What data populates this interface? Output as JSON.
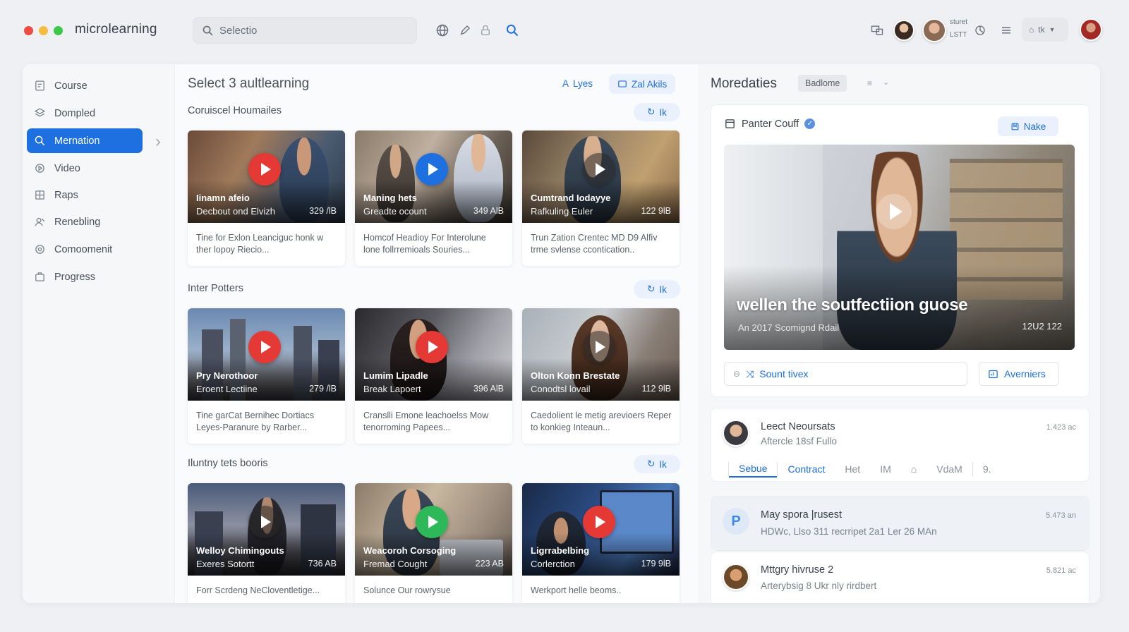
{
  "app": {
    "title": "microlearning",
    "window_dots": [
      "#ee4c43",
      "#f4bd3d",
      "#3ec84a"
    ],
    "accent": "#1e6fe0"
  },
  "topbar": {
    "search_placeholder": "Selectio",
    "icons": [
      "globe-icon",
      "pen-icon",
      "lock-icon",
      "search-icon"
    ],
    "user_name": "sturet",
    "user_meta": "LSTT",
    "language": "tk"
  },
  "sidebar": {
    "items": [
      {
        "label": "Course",
        "icon": "course-icon",
        "active": false
      },
      {
        "label": "Dompled",
        "icon": "stack-icon",
        "active": false
      },
      {
        "label": "Mernation",
        "icon": "search-icon",
        "active": true
      },
      {
        "label": "Video",
        "icon": "video-icon",
        "active": false
      },
      {
        "label": "Raps",
        "icon": "grid-icon",
        "active": false
      },
      {
        "label": "Renebling",
        "icon": "user-icon",
        "active": false
      },
      {
        "label": "Comoomenit",
        "icon": "circle-icon",
        "active": false
      },
      {
        "label": "Progress",
        "icon": "briefcase-icon",
        "active": false
      }
    ]
  },
  "main": {
    "title": "Select 3 aultlearning",
    "actions": {
      "lyes": "Lyes",
      "zal_akils": "Zal Akils"
    },
    "sections": [
      {
        "title": "Coruiscel Houmailes",
        "chip": "Ik",
        "cards": [
          {
            "title": "Iinamn afeio",
            "subtitle": "Decbout ond Elvizh",
            "duration": "329 /lB",
            "description": "Tine for Exlon Leanciguc honk w ther lopoy Riecio...",
            "play_color": "#e53935"
          },
          {
            "title": "Maning hets",
            "subtitle": "Greadte ocount",
            "duration": "349 AlB",
            "description": "Homcof Headioy For Interolune lone follrremioals Souries...",
            "play_color": "#1e6fe0"
          },
          {
            "title": "Cumtrand Iodayye",
            "subtitle": "Rafkuling Euler",
            "duration": "122 9lB",
            "description": "Trun Zation Crentec MD D9 Alfiv trme svlense ccontication..",
            "play_color": "dark"
          }
        ]
      },
      {
        "title": "Inter Potters",
        "chip": "Ik",
        "cards": [
          {
            "title": "Pry Nerothoor",
            "subtitle": "Eroent Lectiine",
            "duration": "279 /lB",
            "description": "Tine garCat Bernihec Dortiacs Leyes-Paranure by Rarber...",
            "play_color": "#e53935"
          },
          {
            "title": "Lumim Lipadle",
            "subtitle": "Break Lapoert",
            "duration": "396 AlB",
            "description": "Cranslli Emone leachoelss Mow tenorroming Papees...",
            "play_color": "#e53935"
          },
          {
            "title": "Olton Konn Brestate",
            "subtitle": "Conodtsl lovail",
            "duration": "112 9lB",
            "description": "Caedolient le metig arevioers Reper to konkieg Inteaun...",
            "play_color": "dark"
          }
        ]
      },
      {
        "title": "Iluntny tets booris",
        "chip": "Ik",
        "cards": [
          {
            "title": "Welloy Chimingouts",
            "subtitle": "Exeres Sotortt",
            "duration": "736 AB",
            "description": "Forr Scrdeng NeCloventletige...",
            "play_color": "dark"
          },
          {
            "title": "Weacoroh Corsoging",
            "subtitle": "Fremad Cought",
            "duration": "223 AB",
            "description": "Solunce Our rowrysue",
            "play_color": "#2fb85a"
          },
          {
            "title": "Ligrrabelbing",
            "subtitle": "Corlerction",
            "duration": "179 9lB",
            "description": "Werkport helle beoms..",
            "play_color": "#e53935"
          }
        ]
      }
    ]
  },
  "right": {
    "title": "Moredaties",
    "badge": "Badlome",
    "panel": {
      "author": "Panter Couff",
      "verified": true,
      "action": "Nake",
      "video_title": "wellen the soutfectiion guose",
      "video_sub": "An 2017 Scomignd Rdail",
      "video_duration": "12U2 122",
      "left_button": "Sount tivex",
      "right_button": "Averniers"
    },
    "contact": {
      "name": "Leect Neoursats",
      "subtitle": "Aftercle 18sf Fullo",
      "time": "1.423 ac",
      "tabs": [
        "Sebue",
        "Contract",
        "Het",
        "IM",
        "VdaM",
        "9."
      ]
    },
    "messages": [
      {
        "name": "May spora |rusest",
        "text": "HDWc, Llso 311 recrripet 2a1 Ler 26 MAn",
        "time": "5.473 an",
        "avatar_letter": "P"
      },
      {
        "name": "Mttgry hivruse 2",
        "text": "Arterybsig 8 Ukr nly rirdbert",
        "time": "5.821 ac",
        "avatar_letter": ""
      }
    ]
  }
}
